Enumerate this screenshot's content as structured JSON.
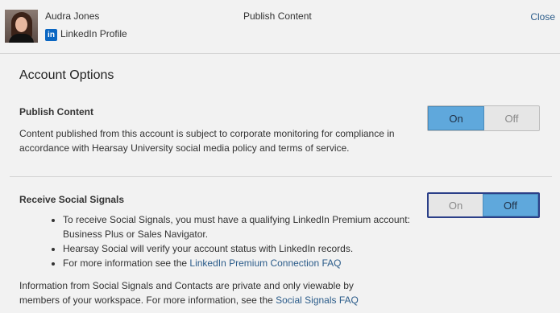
{
  "header": {
    "user_name": "Audra Jones",
    "network_badge": "in",
    "network_label": "LinkedIn Profile",
    "title": "Publish Content",
    "close_label": "Close"
  },
  "section_title": "Account Options",
  "publish": {
    "title": "Publish Content",
    "description": "Content published from this account is subject to corporate monitoring for compliance in accordance with Hearsay University social media policy and terms of service.",
    "toggle": {
      "on_label": "On",
      "off_label": "Off",
      "state": "on"
    }
  },
  "signals": {
    "title": "Receive Social Signals",
    "toggle": {
      "on_label": "On",
      "off_label": "Off",
      "state": "off"
    },
    "bullets": [
      {
        "text": "To receive Social Signals, you must have a qualifying LinkedIn Premium account: Business Plus or Sales Navigator."
      },
      {
        "text": "Hearsay Social will verify your account status with LinkedIn records."
      },
      {
        "prefix": "For more information see the ",
        "link": "LinkedIn Premium Connection FAQ"
      }
    ],
    "footer_prefix": "Information from Social Signals and Contacts are private and only viewable by members of your workspace. For more information, see the ",
    "footer_link": "Social Signals FAQ"
  },
  "colors": {
    "toggle_active": "#5fa8dc",
    "link": "#2b5c8a",
    "focus_border": "#2b3f88"
  }
}
